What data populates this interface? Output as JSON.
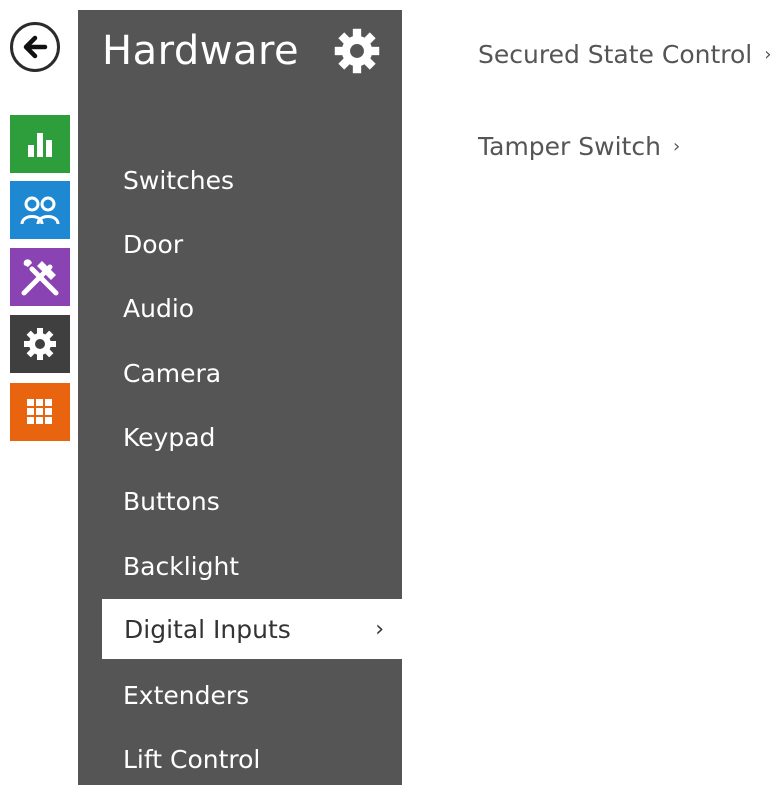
{
  "header": {
    "title": "Hardware"
  },
  "rail": {
    "icons": [
      {
        "name": "back",
        "color": "#2b2b2b"
      },
      {
        "name": "status",
        "color": "#2e9e3d"
      },
      {
        "name": "directory",
        "color": "#1e88d2"
      },
      {
        "name": "services",
        "color": "#8a43b3"
      },
      {
        "name": "hardware",
        "color": "#3f3f3f"
      },
      {
        "name": "system",
        "color": "#e8640f"
      }
    ]
  },
  "menu": {
    "items": [
      {
        "label": "Switches"
      },
      {
        "label": "Door"
      },
      {
        "label": "Audio"
      },
      {
        "label": "Camera"
      },
      {
        "label": "Keypad"
      },
      {
        "label": "Buttons"
      },
      {
        "label": "Backlight"
      },
      {
        "label": "Digital Inputs",
        "active": true,
        "chevron": "›"
      },
      {
        "label": "Extenders"
      },
      {
        "label": "Lift Control"
      }
    ]
  },
  "content": {
    "links": [
      {
        "label": "Secured State Control",
        "chevron": "›"
      },
      {
        "label": "Tamper Switch",
        "chevron": "›"
      }
    ]
  },
  "colors": {
    "menu_bg": "#555555",
    "active_bg": "#ffffff",
    "text_light": "#ffffff",
    "text_dark": "#555555"
  }
}
